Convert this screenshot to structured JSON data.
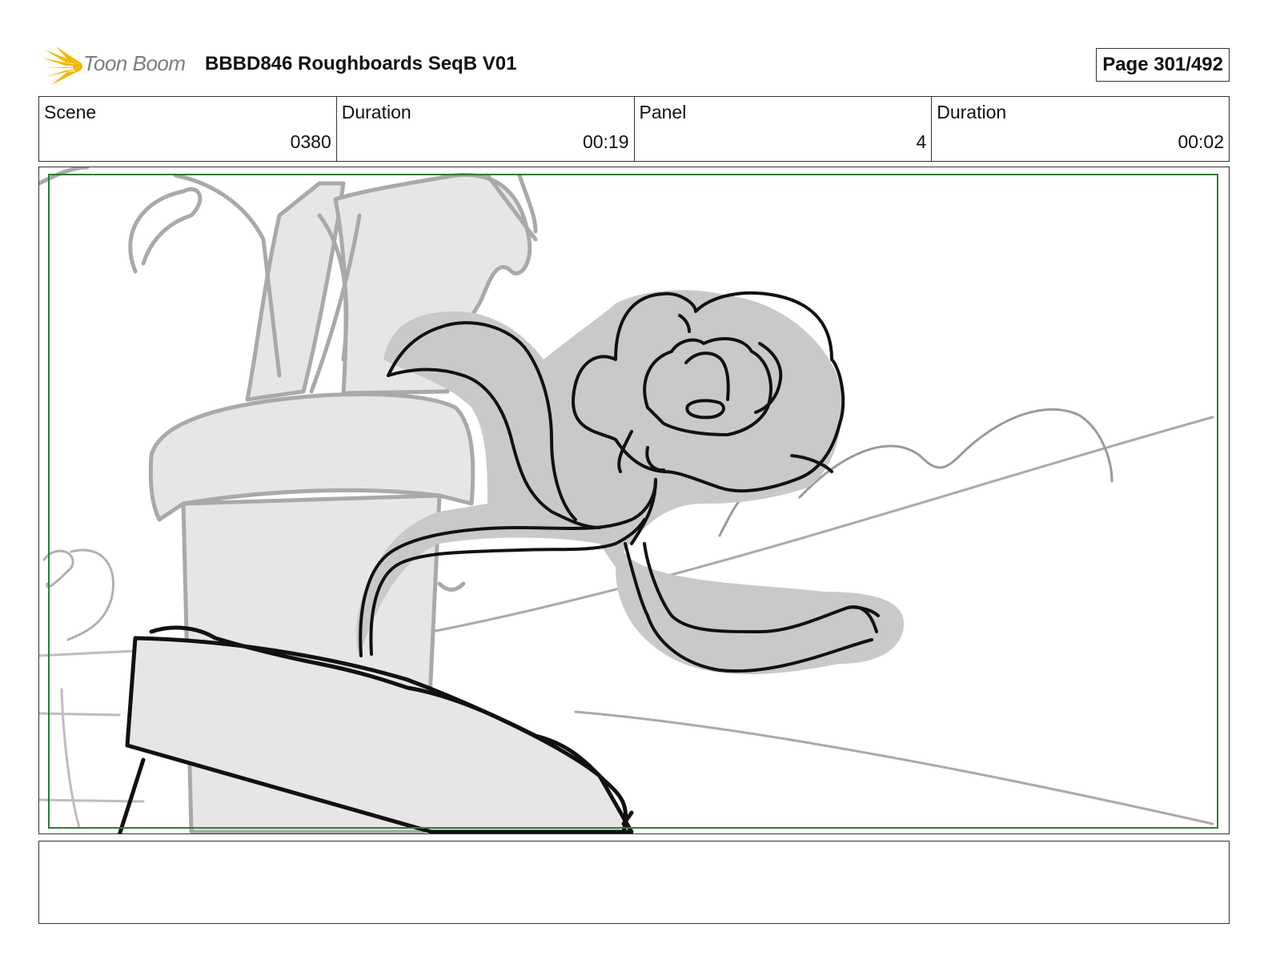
{
  "header": {
    "logo_text": "Toon Boom",
    "title": "BBBD846 Roughboards SeqB V01",
    "page": "Page 301/492"
  },
  "info": {
    "scene_label": "Scene",
    "scene_value": "0380",
    "scene_duration_label": "Duration",
    "scene_duration_value": "00:19",
    "panel_label": "Panel",
    "panel_value": "4",
    "panel_duration_label": "Duration",
    "panel_duration_value": "00:02"
  },
  "colors": {
    "logo_star": "#f5b800",
    "safe_frame": "#2e7d32",
    "sketch_fill": "#e6e6e6",
    "sketch_shadow": "#c9c9c9",
    "sketch_line": "#111111"
  },
  "icons": {
    "logo": "starburst-icon"
  }
}
